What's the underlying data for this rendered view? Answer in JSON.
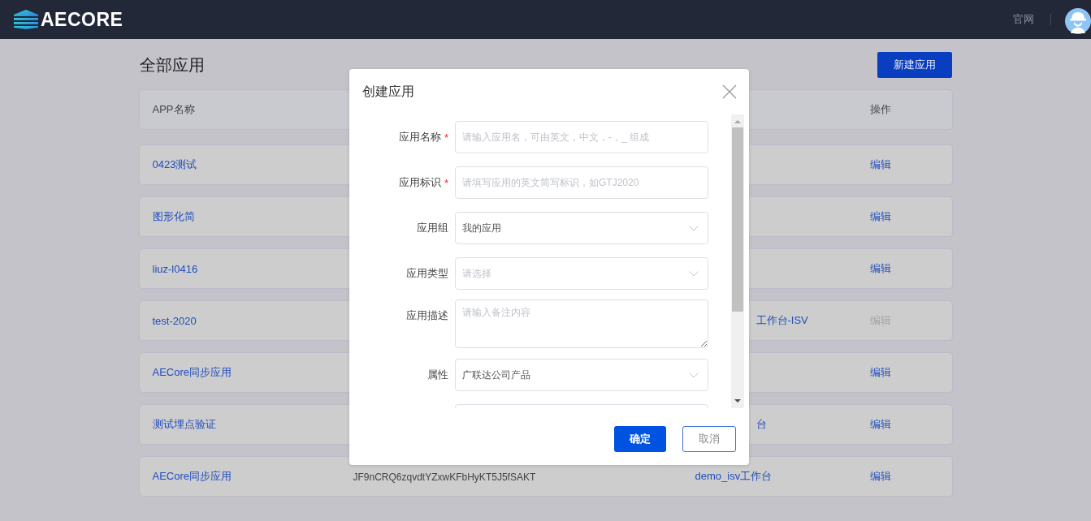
{
  "header": {
    "logo_text": "AECORE",
    "link": "官网"
  },
  "page": {
    "title": "全部应用",
    "new_button": "新建应用"
  },
  "table": {
    "columns": [
      "APP名称",
      "操作"
    ],
    "rows": [
      {
        "name": "0423测试",
        "action": "编辑",
        "disabled": false
      },
      {
        "name": "图形化简",
        "action": "编辑",
        "disabled": false
      },
      {
        "name": "liuz-l0416",
        "action": "编辑",
        "disabled": false
      },
      {
        "name": "test-2020",
        "column_3": "工作台-ISV",
        "action": "编辑",
        "disabled": true
      },
      {
        "name": "AECore同步应用",
        "action": "编辑",
        "disabled": false
      },
      {
        "name": "测试埋点验证",
        "column_3": "台",
        "action": "编辑",
        "disabled": false
      },
      {
        "name": "AECore同步应用",
        "column_2": "JF9nCRQ6zqvdtYZxwKFbHyKT5J5fSAKT",
        "column_3": "demo_isv工作台",
        "action": "编辑",
        "disabled": false
      }
    ]
  },
  "modal": {
    "title": "创建应用",
    "fields": [
      {
        "label": "应用名称",
        "required": true,
        "kind": "input",
        "placeholder": "请输入应用名，可由英文，中文，-，_ 组成"
      },
      {
        "label": "应用标识",
        "required": true,
        "kind": "input",
        "placeholder": "请填写应用的英文简写标识，如GTJ2020"
      },
      {
        "label": "应用组",
        "required": false,
        "kind": "select",
        "value": "我的应用"
      },
      {
        "label": "应用类型",
        "required": false,
        "kind": "select",
        "placeholder": "请选择"
      },
      {
        "label": "应用描述",
        "required": false,
        "kind": "textarea",
        "placeholder": "请输入备注内容"
      },
      {
        "label": "属性",
        "required": false,
        "kind": "select",
        "value": "广联达公司产品"
      },
      {
        "kind": "input"
      }
    ],
    "required_mark": "*",
    "confirm": "确定",
    "cancel": "取消"
  }
}
